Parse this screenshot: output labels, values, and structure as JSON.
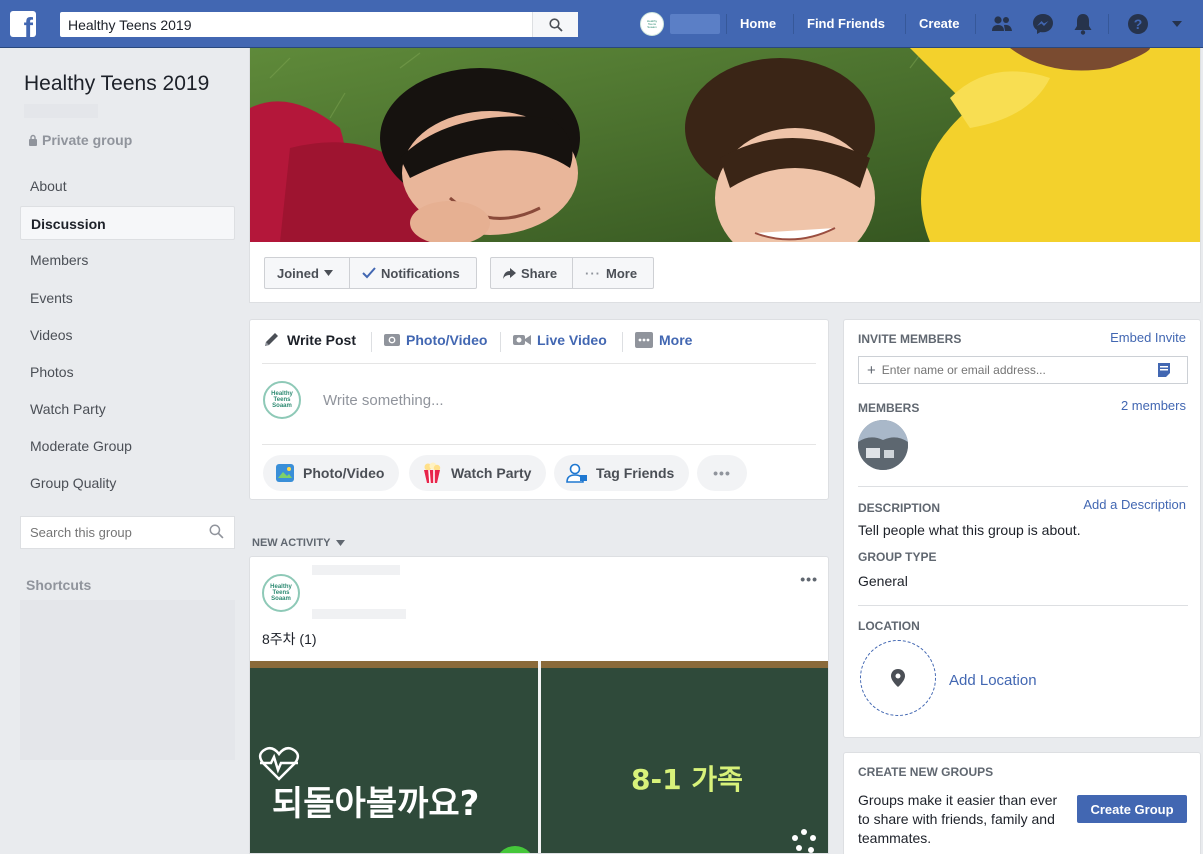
{
  "topbar": {
    "search_value": "Healthy Teens 2019",
    "nav": {
      "home": "Home",
      "find_friends": "Find Friends",
      "create": "Create"
    },
    "brand_color": "#4267b2"
  },
  "sidebar": {
    "group_name": "Healthy Teens 2019",
    "privacy": "Private group",
    "items": [
      {
        "label": "About"
      },
      {
        "label": "Discussion",
        "active": true
      },
      {
        "label": "Members"
      },
      {
        "label": "Events"
      },
      {
        "label": "Videos"
      },
      {
        "label": "Photos"
      },
      {
        "label": "Watch Party"
      },
      {
        "label": "Moderate Group"
      },
      {
        "label": "Group Quality"
      }
    ],
    "search_placeholder": "Search this group",
    "shortcuts_label": "Shortcuts"
  },
  "cover": {
    "buttons": {
      "joined": "Joined",
      "notifications": "Notifications",
      "share": "Share",
      "more": "More"
    }
  },
  "composer": {
    "tabs": {
      "write_post": "Write Post",
      "photo_video": "Photo/Video",
      "live_video": "Live Video",
      "more": "More"
    },
    "avatar_text": "Healthy Teens Soaam",
    "placeholder": "Write something...",
    "actions": {
      "photo_video": "Photo/Video",
      "watch_party": "Watch Party",
      "tag_friends": "Tag Friends"
    }
  },
  "feed": {
    "new_activity": "NEW ACTIVITY",
    "post": {
      "avatar_text": "Healthy Teens Soaam",
      "text": "8주차 (1)",
      "board_left_text": "되돌아볼까요?",
      "board_right_text": "8-1 가족"
    }
  },
  "right": {
    "invite": {
      "heading": "INVITE MEMBERS",
      "embed": "Embed Invite",
      "placeholder": "Enter name or email address..."
    },
    "members": {
      "heading": "MEMBERS",
      "count": "2 members"
    },
    "description": {
      "heading": "DESCRIPTION",
      "link": "Add a Description",
      "text": "Tell people what this group is about."
    },
    "group_type": {
      "heading": "GROUP TYPE",
      "value": "General"
    },
    "location": {
      "heading": "LOCATION",
      "add": "Add Location"
    }
  },
  "create_groups": {
    "heading": "CREATE NEW GROUPS",
    "text": "Groups make it easier than ever to share with friends, family and teammates.",
    "button": "Create Group"
  }
}
